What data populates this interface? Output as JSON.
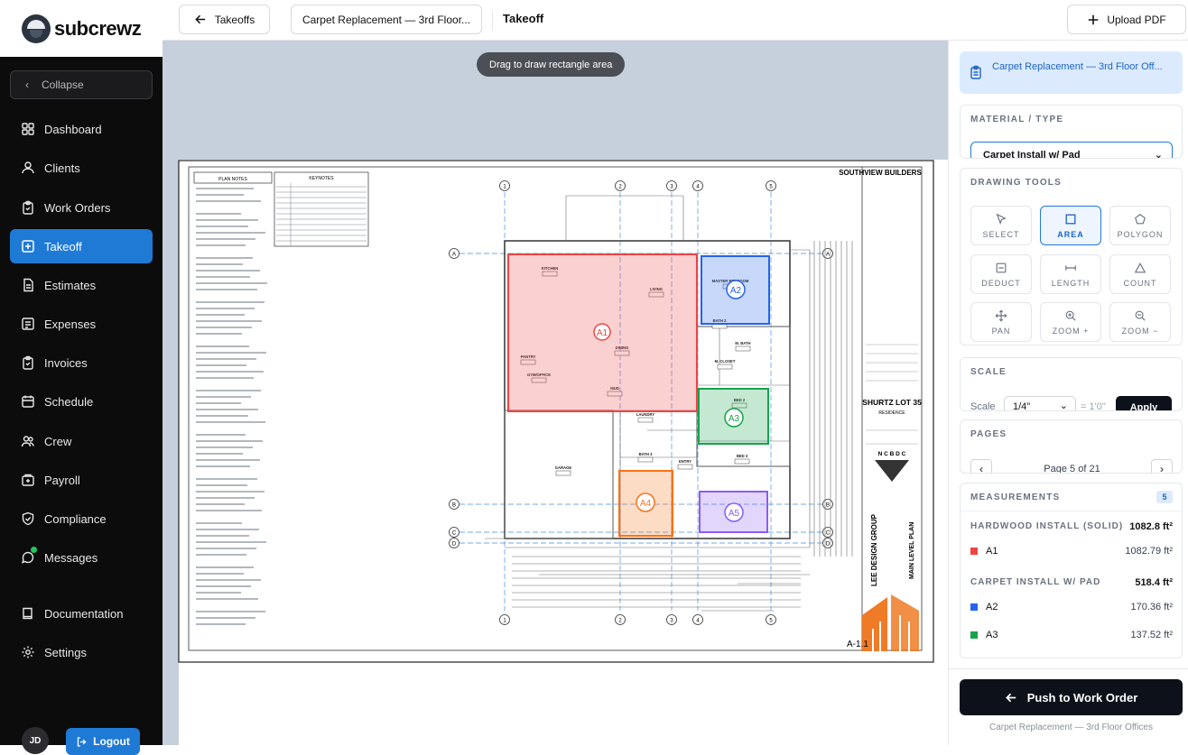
{
  "brand": {
    "name": "subcrewz"
  },
  "sidebar": {
    "collapse_label": "Collapse",
    "items": [
      {
        "label": "Dashboard"
      },
      {
        "label": "Clients"
      },
      {
        "label": "Work Orders"
      },
      {
        "label": "Takeoff",
        "active": true
      },
      {
        "label": "Estimates"
      },
      {
        "label": "Expenses"
      },
      {
        "label": "Invoices"
      },
      {
        "label": "Schedule"
      },
      {
        "label": "Crew"
      },
      {
        "label": "Payroll"
      },
      {
        "label": "Compliance"
      },
      {
        "label": "Messages",
        "unread": true
      },
      {
        "label": "Documentation"
      },
      {
        "label": "Settings"
      }
    ],
    "user_initials": "JD",
    "logout_label": "Logout"
  },
  "topbar": {
    "back_label": "Takeoffs",
    "breadcrumb": "Carpet Replacement — 3rd Floor...",
    "title": "Takeoff",
    "upload_label": "Upload PDF"
  },
  "canvas": {
    "hint": "Drag to draw rectangle area",
    "sheet": {
      "builder": "SOUTHVIEW BUILDERS",
      "project": "SHURTZ LOT 35",
      "subtitle": "RESIDENCE",
      "firm": "LEE DESIGN GROUP",
      "seal": "N C B D C",
      "plan_name": "MAIN LEVEL PLAN",
      "sheet_no": "A-1.1",
      "plan_notes_title": "PLAN NOTES",
      "keynotes_title": "KEYNOTES",
      "rooms": [
        {
          "label": "KITCHEN"
        },
        {
          "label": "LIVING"
        },
        {
          "label": "PANTRY"
        },
        {
          "label": "DINING"
        },
        {
          "label": "GYM/OFFICE"
        },
        {
          "label": "MUD"
        },
        {
          "label": "LAUNDRY"
        },
        {
          "label": "GARAGE"
        },
        {
          "label": "BATH 3"
        },
        {
          "label": "ENTRY"
        },
        {
          "label": "M. BATH"
        },
        {
          "label": "M. CLOSET"
        },
        {
          "label": "BED 2"
        },
        {
          "label": "BED 3"
        },
        {
          "label": "BATH 2"
        },
        {
          "label": "MASTER BEDROOM"
        }
      ],
      "grid_labels_top": [
        "1",
        "2",
        "3",
        "4",
        "5"
      ],
      "grid_labels_side": [
        "A",
        "B",
        "C",
        "D"
      ]
    },
    "areas": [
      {
        "id": "A1",
        "color": "#ef4444"
      },
      {
        "id": "A2",
        "color": "#2563eb"
      },
      {
        "id": "A3",
        "color": "#16a34a"
      },
      {
        "id": "A4",
        "color": "#f97316"
      },
      {
        "id": "A5",
        "color": "#8b5cf6"
      }
    ]
  },
  "panel": {
    "job_title": "Carpet Replacement — 3rd Floor Off...",
    "material": {
      "heading": "MATERIAL / TYPE",
      "selected": "Carpet Install w/ Pad"
    },
    "tools": {
      "heading": "DRAWING TOOLS",
      "items": [
        {
          "label": "SELECT"
        },
        {
          "label": "AREA",
          "active": true
        },
        {
          "label": "POLYGON"
        },
        {
          "label": "DEDUCT"
        },
        {
          "label": "LENGTH"
        },
        {
          "label": "COUNT"
        },
        {
          "label": "PAN"
        },
        {
          "label": "ZOOM +"
        },
        {
          "label": "ZOOM −"
        }
      ]
    },
    "scale": {
      "heading": "SCALE",
      "label": "Scale",
      "value": "1/4\"",
      "equals": "= 1'0\"",
      "apply": "Apply"
    },
    "pages": {
      "heading": "PAGES",
      "current": "Page 5 of 21"
    },
    "measurements": {
      "heading": "MEASUREMENTS",
      "count": "5",
      "groups": [
        {
          "name": "HARDWOOD INSTALL (SOLID)",
          "total": "1082.8 ft²",
          "rows": [
            {
              "id": "A1",
              "value": "1082.79 ft²",
              "color": "#ef4444"
            }
          ]
        },
        {
          "name": "CARPET INSTALL W/ PAD",
          "total": "518.4 ft²",
          "rows": [
            {
              "id": "A2",
              "value": "170.36 ft²",
              "color": "#2563eb"
            },
            {
              "id": "A3",
              "value": "137.52 ft²",
              "color": "#16a34a"
            }
          ]
        }
      ]
    },
    "push_label": "Push to Work Order",
    "footer": "Carpet Replacement — 3rd Floor Offices"
  }
}
